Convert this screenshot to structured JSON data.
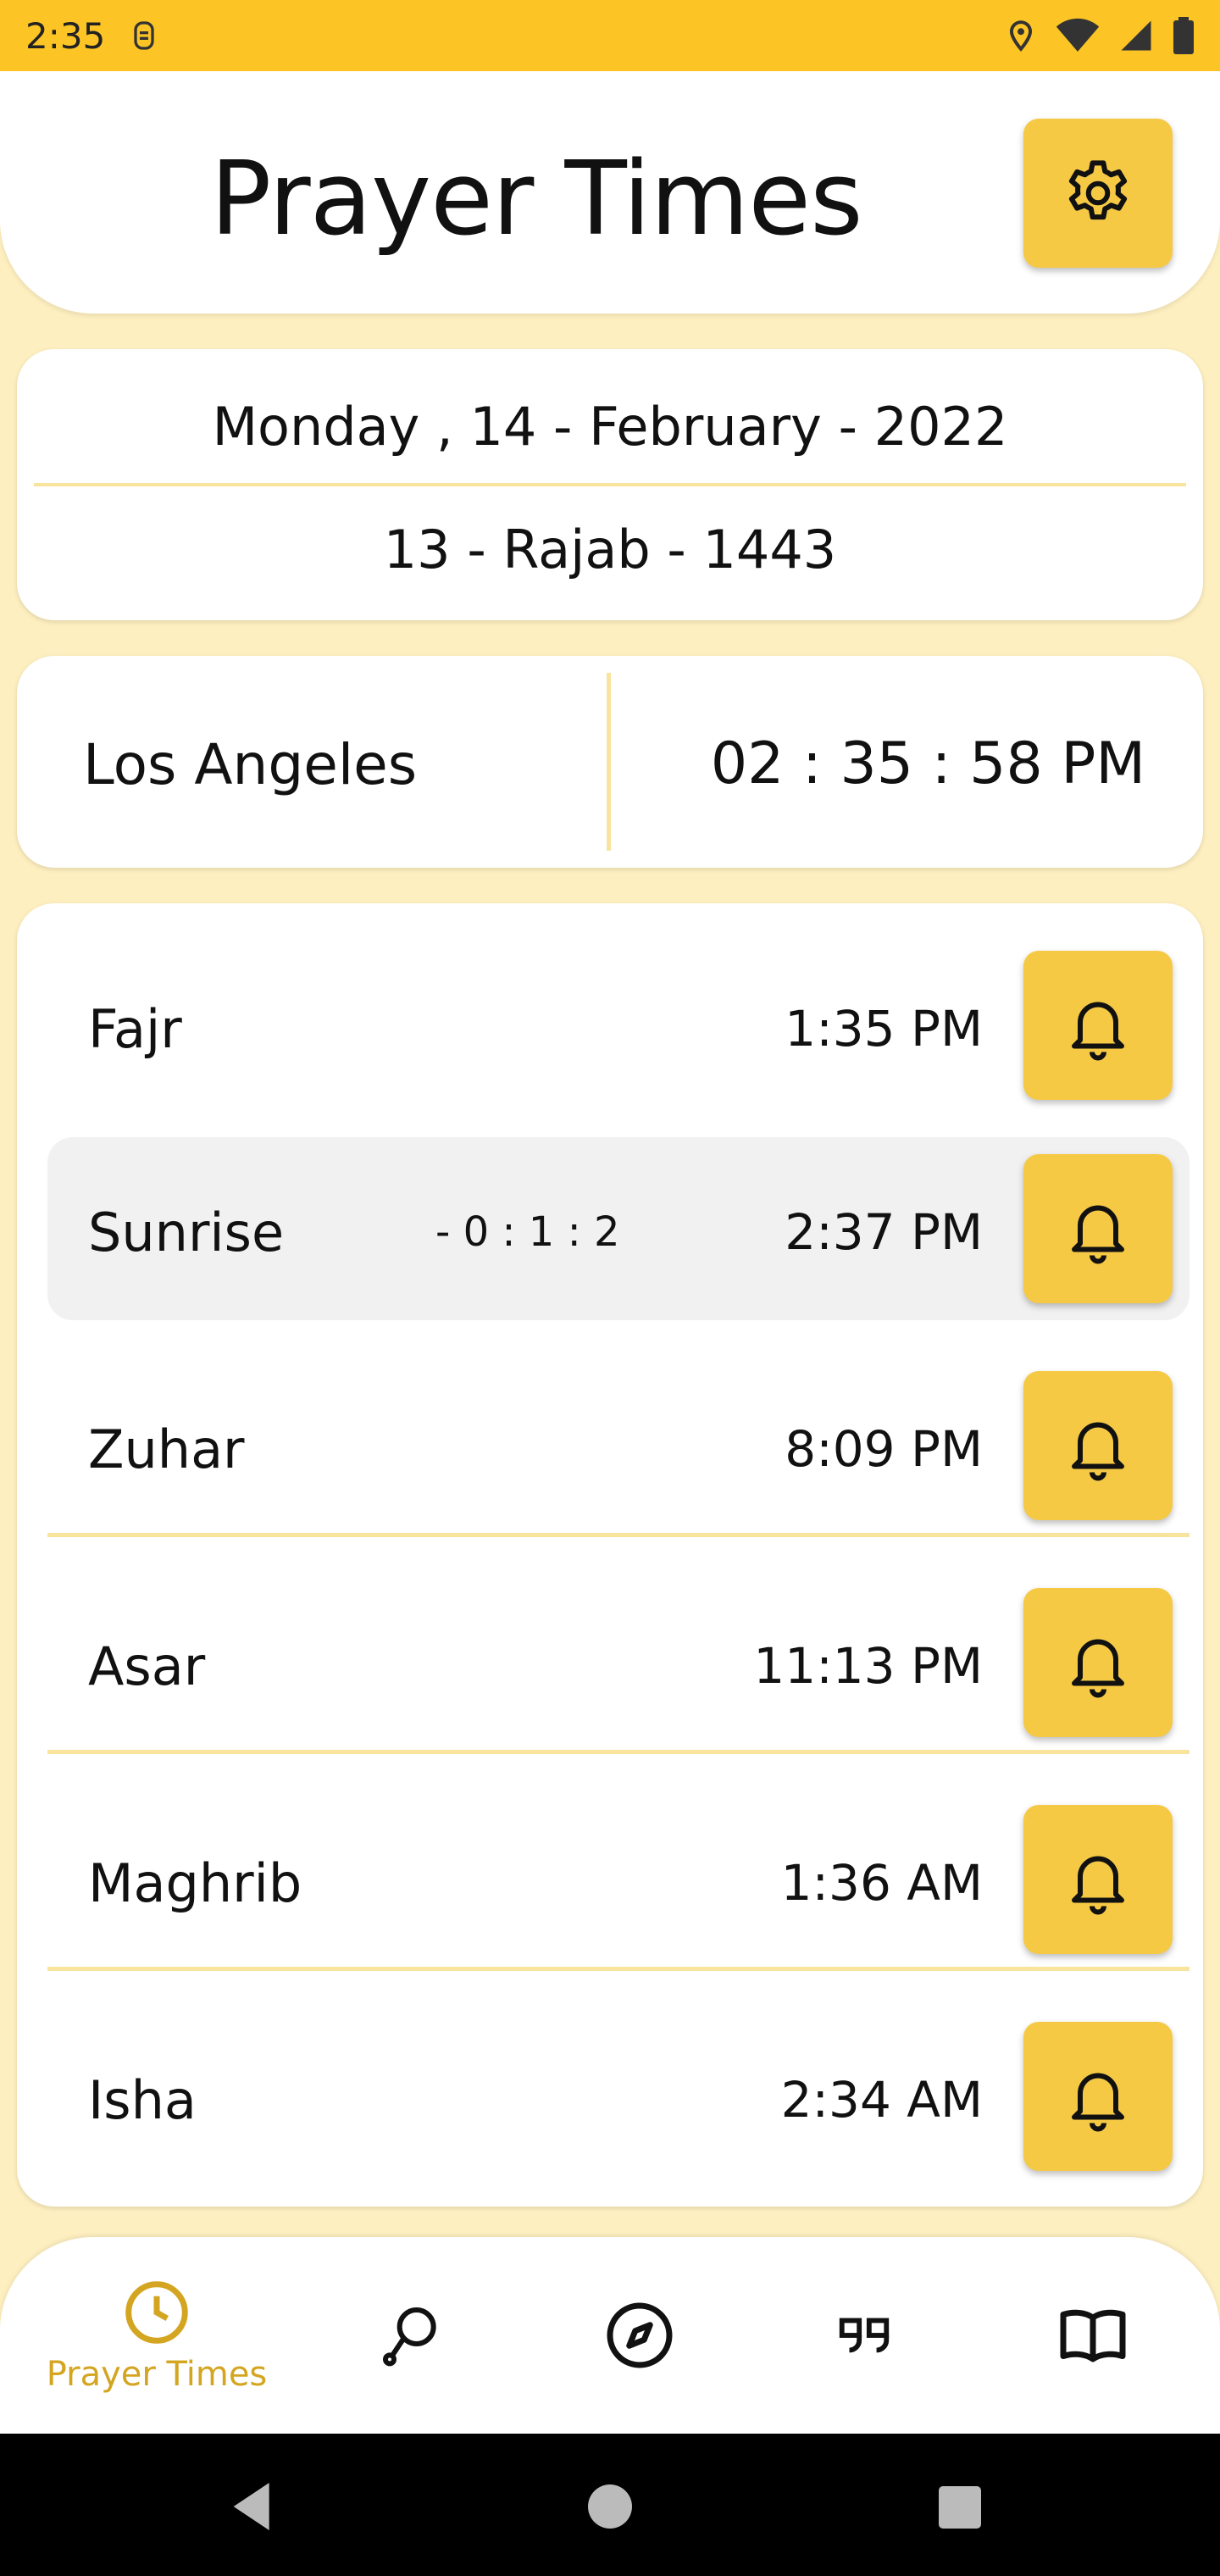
{
  "status_bar": {
    "time": "2:35"
  },
  "header": {
    "title": "Prayer Times",
    "settings_icon": "gear-icon"
  },
  "dates": {
    "gregorian": "Monday , 14 - February - 2022",
    "hijri": "13 - Rajab - 1443"
  },
  "location": {
    "city": "Los Angeles",
    "clock": "02 : 35 : 58 PM"
  },
  "prayers": [
    {
      "name": "Fajr",
      "countdown": "",
      "time": "1:35 PM"
    },
    {
      "name": "Sunrise",
      "countdown": "- 0 : 1 : 2",
      "time": "2:37 PM"
    },
    {
      "name": "Zuhar",
      "countdown": "",
      "time": "8:09 PM"
    },
    {
      "name": "Asar",
      "countdown": "",
      "time": "11:13 PM"
    },
    {
      "name": "Maghrib",
      "countdown": "",
      "time": "1:36 AM"
    },
    {
      "name": "Isha",
      "countdown": "",
      "time": "2:34 AM"
    }
  ],
  "bottom_nav": {
    "items": [
      {
        "icon": "clock-icon",
        "label": "Prayer Times",
        "active": true
      },
      {
        "icon": "tasbih-icon",
        "label": ""
      },
      {
        "icon": "compass-icon",
        "label": ""
      },
      {
        "icon": "quote-icon",
        "label": ""
      },
      {
        "icon": "book-icon",
        "label": ""
      }
    ]
  },
  "colors": {
    "accent": "#fcc424",
    "button": "#f6c945",
    "background": "#fdefbf",
    "active_nav": "#d4a520"
  }
}
